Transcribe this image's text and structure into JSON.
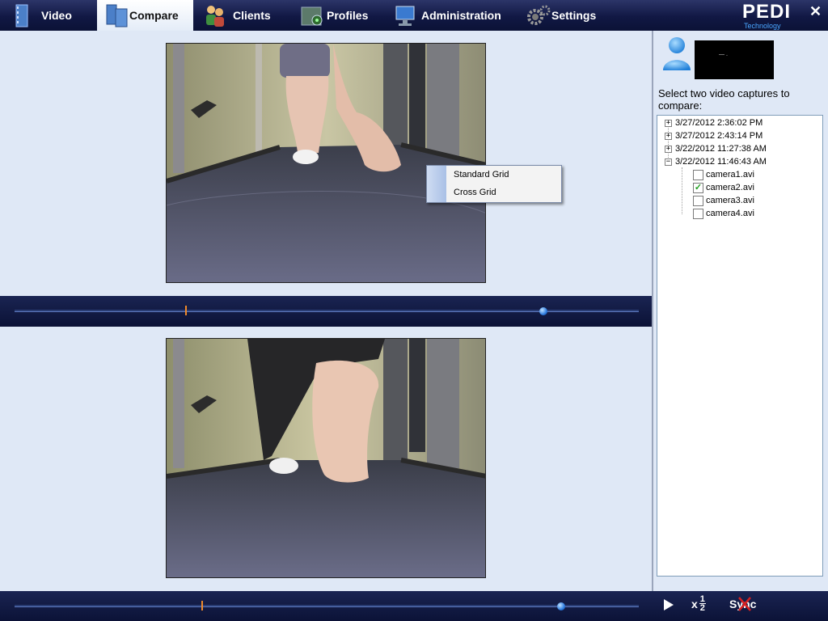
{
  "nav": {
    "tabs": [
      {
        "label": "Video",
        "icon": "film-icon"
      },
      {
        "label": "Compare",
        "icon": "compare-icon"
      },
      {
        "label": "Clients",
        "icon": "clients-icon"
      },
      {
        "label": "Profiles",
        "icon": "profiles-icon"
      },
      {
        "label": "Administration",
        "icon": "administration-icon"
      },
      {
        "label": "Settings",
        "icon": "gear-icon"
      }
    ],
    "active_tab": "Compare",
    "logo_text": "PEDI",
    "logo_subtext": "Technology",
    "close_glyph": "✕"
  },
  "context_menu": {
    "items": [
      "Standard Grid",
      "Cross Grid"
    ]
  },
  "seek_top": {
    "marker_fraction": 0.274,
    "position_fraction": 0.847
  },
  "seek_bottom": {
    "marker_fraction": 0.301,
    "position_fraction": 0.875
  },
  "sidebar": {
    "user_name": "— .",
    "select_label": "Select two video captures to compare:",
    "tree": [
      {
        "label": "3/27/2012 2:36:02 PM",
        "expanded": false
      },
      {
        "label": "3/27/2012 2:43:14 PM",
        "expanded": false
      },
      {
        "label": "3/22/2012 11:27:38 AM",
        "expanded": false
      },
      {
        "label": "3/22/2012 11:46:43 AM",
        "expanded": true,
        "children": [
          {
            "label": "camera1.avi",
            "checked": false
          },
          {
            "label": "camera2.avi",
            "checked": true
          },
          {
            "label": "camera3.avi",
            "checked": false
          },
          {
            "label": "camera4.avi",
            "checked": false
          }
        ]
      }
    ]
  },
  "playback": {
    "speed_prefix": "x",
    "speed_num": "1",
    "speed_den": "2",
    "sync_label": "Sync",
    "sync_enabled": false
  },
  "colors": {
    "nav_bg": "#111844",
    "page_bg": "#dfe8f6",
    "marker": "#f08a2a",
    "knob": "#2e7de0",
    "checkmark": "#21a121"
  }
}
